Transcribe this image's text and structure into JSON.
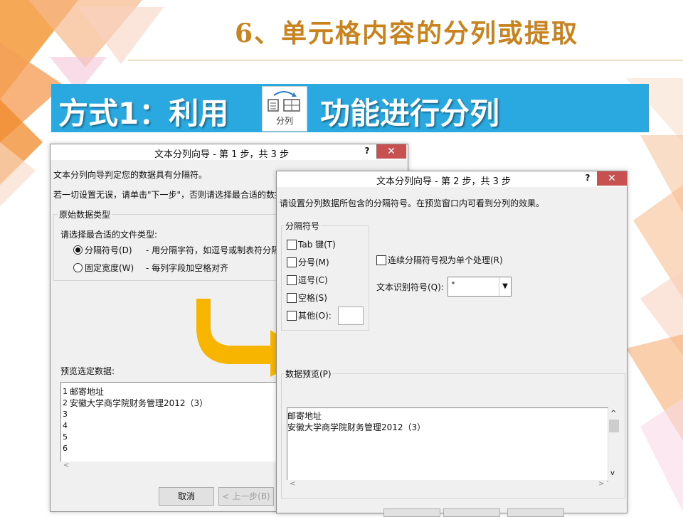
{
  "slide": {
    "title": "6、单元格内容的分列或提取",
    "banner_prefix": "方式1：利用",
    "banner_icon_label": "分列",
    "banner_suffix": "功能进行分列"
  },
  "dialog1": {
    "title": "文本分列向导 - 第 1 步，共 3 步",
    "help": "?",
    "close": "✕",
    "intro": "文本分列向导判定您的数据具有分隔符。",
    "next_hint": "若一切设置无误，请单击\"下一步\"，否则请选择最合适的数据",
    "group_title": "原始数据类型",
    "choose_label": "请选择最合适的文件类型:",
    "radio_delimited": "分隔符号(D)",
    "radio_delimited_desc": "- 用分隔字符，如逗号或制表符分隔",
    "radio_fixed": "固定宽度(W)",
    "radio_fixed_desc": "- 每列字段加空格对齐",
    "preview_label": "预览选定数据:",
    "row_numbers": [
      "1",
      "2",
      "3",
      "4",
      "5",
      "6"
    ],
    "preview_rows": [
      "邮寄地址",
      "安徽大学商学院财务管理2012（3）"
    ],
    "cancel": "取消",
    "back": "< 上一步(B)"
  },
  "dialog2": {
    "title": "文本分列向导 - 第 2 步，共 3 步",
    "help": "?",
    "close": "✕",
    "intro": "请设置分列数据所包含的分隔符号。在预览窗口内可看到分列的效果。",
    "group_title": "分隔符号",
    "checks": [
      "Tab 键(T)",
      "分号(M)",
      "逗号(C)",
      "空格(S)",
      "其他(O):"
    ],
    "consecutive": "连续分隔符号视为单个处理(R)",
    "qualifier_label": "文本识别符号(Q):",
    "qualifier_value": "\"",
    "preview_label": "数据预览(P)",
    "preview_rows": [
      "邮寄地址",
      "安徽大学商学院财务管理2012（3）"
    ]
  },
  "colors": {
    "banner": "#2aa8e0",
    "title": "#c8821e",
    "arrow": "#f7b500",
    "close": "#c75050"
  }
}
